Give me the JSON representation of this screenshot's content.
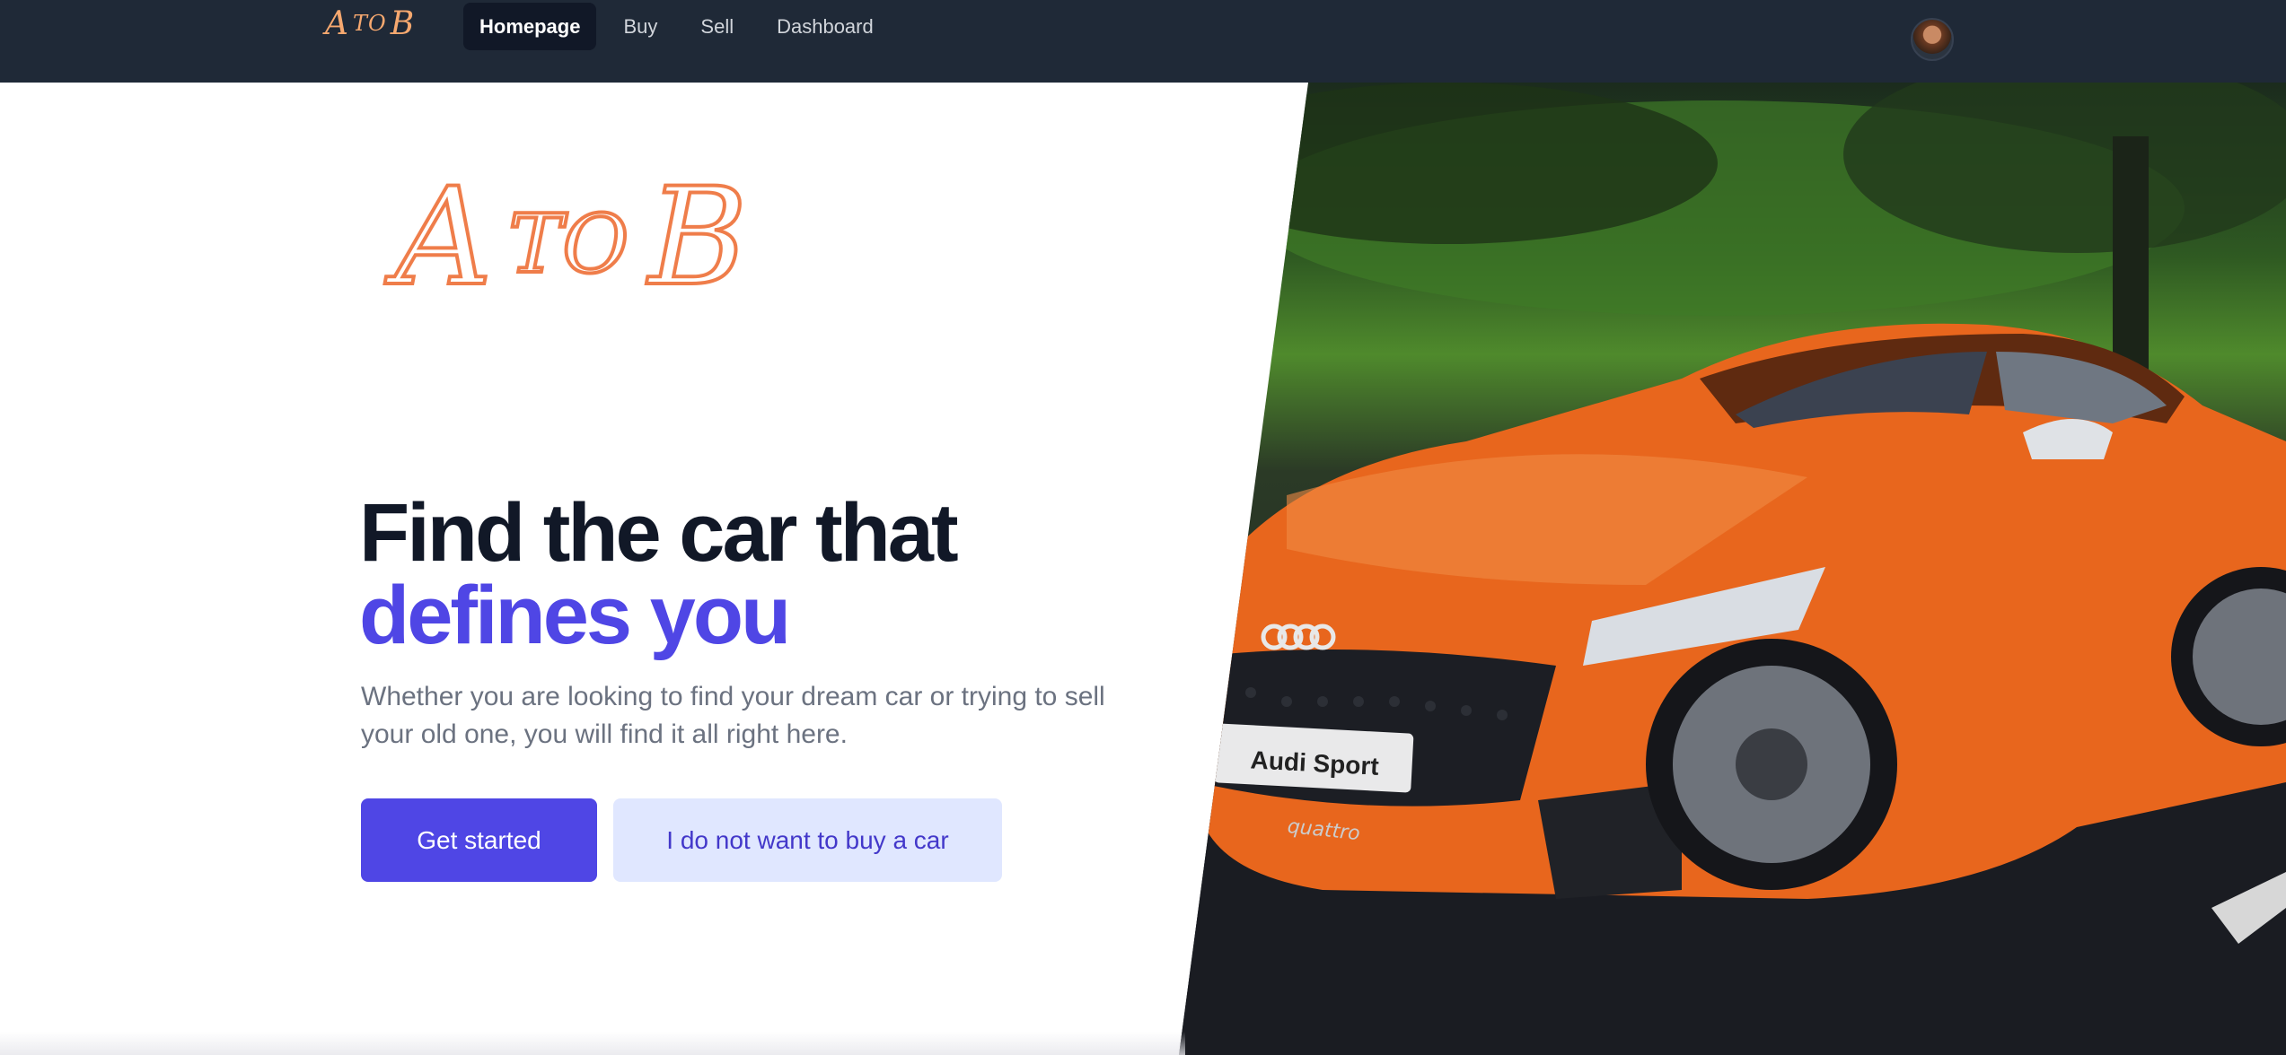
{
  "nav": {
    "logo": {
      "a": "A",
      "to": "TO",
      "b": "B"
    },
    "links": [
      {
        "label": "Homepage",
        "active": true
      },
      {
        "label": "Buy",
        "active": false
      },
      {
        "label": "Sell",
        "active": false
      },
      {
        "label": "Dashboard",
        "active": false
      }
    ]
  },
  "hero": {
    "logo": {
      "a": "A",
      "to": "TO",
      "b": "B"
    },
    "headline_line1": "Find the car that",
    "headline_line2": "defines you",
    "subtext": "Whether you are looking to find your dream car or trying to sell your old one, you will find it all right here.",
    "primary_button": "Get started",
    "secondary_button": "I do not want to buy a car",
    "image_plate_text": "Audi Sport",
    "image_grille_text": "quattro"
  },
  "colors": {
    "nav_bg": "#1f2937",
    "accent": "#4f46e5",
    "secondary_bg": "#e0e7ff",
    "logo": "#ef7d4a",
    "car": "#e8661d"
  }
}
